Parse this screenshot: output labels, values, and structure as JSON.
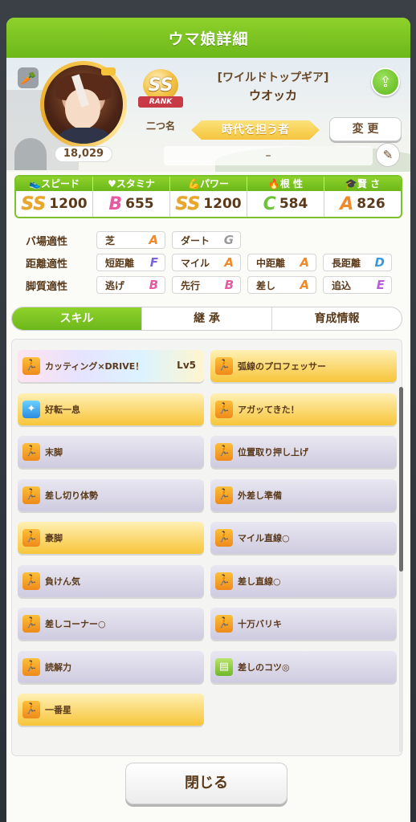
{
  "window": {
    "title": "ウマ娘詳細"
  },
  "profile": {
    "fans": "18,029",
    "rank": "SS",
    "rank_ribbon": "RANK",
    "rank_title": "二つ名",
    "costume": "[ワイルドトップギア]",
    "name": "ウオッカ",
    "title_badge": "時代を担う者",
    "change_label": "変 更",
    "nickname": "–"
  },
  "stats": [
    {
      "label": "スピード",
      "icon": "shoe-icon",
      "grade": "SS",
      "value": "1200"
    },
    {
      "label": "スタミナ",
      "icon": "heart-icon",
      "grade": "B",
      "value": "655"
    },
    {
      "label": "パワー",
      "icon": "muscle-icon",
      "grade": "SS",
      "value": "1200"
    },
    {
      "label": "根 性",
      "icon": "flame-icon",
      "grade": "C",
      "value": "584"
    },
    {
      "label": "賢 さ",
      "icon": "graduation-cap-icon",
      "grade": "A",
      "value": "826"
    }
  ],
  "aptitude": {
    "track": {
      "label": "バ場適性",
      "items": [
        {
          "name": "芝",
          "grade": "A"
        },
        {
          "name": "ダート",
          "grade": "G"
        }
      ]
    },
    "distance": {
      "label": "距離適性",
      "items": [
        {
          "name": "短距離",
          "grade": "F"
        },
        {
          "name": "マイル",
          "grade": "A"
        },
        {
          "name": "中距離",
          "grade": "A"
        },
        {
          "name": "長距離",
          "grade": "D"
        }
      ]
    },
    "style": {
      "label": "脚質適性",
      "items": [
        {
          "name": "逃げ",
          "grade": "B"
        },
        {
          "name": "先行",
          "grade": "B"
        },
        {
          "name": "差し",
          "grade": "A"
        },
        {
          "name": "追込",
          "grade": "E"
        }
      ]
    }
  },
  "tabs": [
    "スキル",
    "継 承",
    "育成情報"
  ],
  "skills": [
    {
      "name": "カッティング×DRIVE！",
      "level": "Lv5",
      "style": "rainbow",
      "icon": "running-icon"
    },
    {
      "name": "弧線のプロフェッサー",
      "level": "",
      "style": "gold",
      "icon": "running-icon"
    },
    {
      "name": "好転一息",
      "level": "",
      "style": "gold",
      "icon": "sparkle-icon"
    },
    {
      "name": "アガッてきた！",
      "level": "",
      "style": "gold",
      "icon": "running-icon"
    },
    {
      "name": "末脚",
      "level": "",
      "style": "normal",
      "icon": "running-icon"
    },
    {
      "name": "位置取り押し上げ",
      "level": "",
      "style": "normal",
      "icon": "running-icon"
    },
    {
      "name": "差し切り体勢",
      "level": "",
      "style": "normal",
      "icon": "running-icon"
    },
    {
      "name": "外差し準備",
      "level": "",
      "style": "normal",
      "icon": "running-icon"
    },
    {
      "name": "豪脚",
      "level": "",
      "style": "gold",
      "icon": "running-icon"
    },
    {
      "name": "マイル直線○",
      "level": "",
      "style": "normal",
      "icon": "running-icon"
    },
    {
      "name": "負けん気",
      "level": "",
      "style": "normal",
      "icon": "running-icon"
    },
    {
      "name": "差し直線○",
      "level": "",
      "style": "normal",
      "icon": "running-icon"
    },
    {
      "name": "差しコーナー○",
      "level": "",
      "style": "normal",
      "icon": "running-icon"
    },
    {
      "name": "十万バリキ",
      "level": "",
      "style": "normal",
      "icon": "running-icon"
    },
    {
      "name": "読解力",
      "level": "",
      "style": "normal",
      "icon": "running-icon"
    },
    {
      "name": "差しのコツ◎",
      "level": "",
      "style": "normal",
      "icon": "book-icon"
    },
    {
      "name": "一番星",
      "level": "",
      "style": "gold",
      "icon": "running-icon"
    }
  ],
  "footer": {
    "close_label": "閉じる"
  }
}
